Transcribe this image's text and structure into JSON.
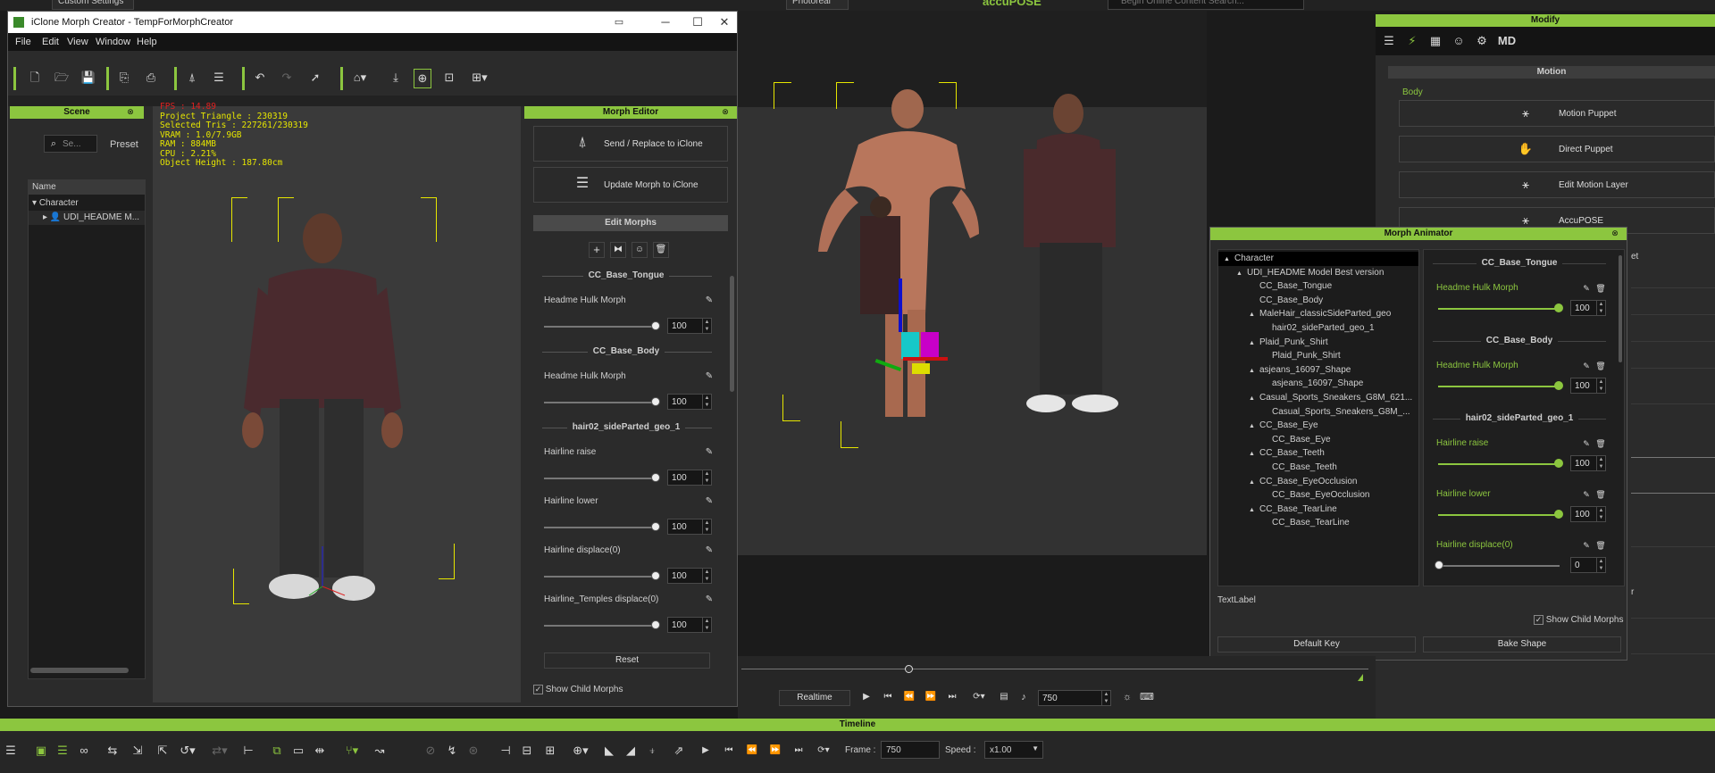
{
  "top_toolbar": {
    "preset_dropdown": "Custom Settings",
    "render_mode": "Photoreal",
    "accupose_logo": "accuPOSE",
    "search_placeholder": "Begin Online Content Search..."
  },
  "morph_creator": {
    "title": "iClone Morph Creator - TempForMorphCreator",
    "menu": [
      "File",
      "Edit",
      "View",
      "Window",
      "Help"
    ],
    "scene_panel": {
      "title": "Scene",
      "search_placeholder": "Se...",
      "preset_label": "Preset",
      "column_name": "Name",
      "tree": [
        {
          "label": "Character",
          "level": 0
        },
        {
          "label": "UDI_HEADME M...",
          "level": 1
        }
      ]
    },
    "stats": {
      "fps": "FPS : 14.89",
      "project_triangle": "Project Triangle : 230319",
      "selected_tris": "Selected Tris : 227261/230319",
      "vram": "VRAM : 1.0/7.9GB",
      "ram": "RAM : 884MB",
      "cpu": "CPU : 2.21%",
      "object_height": "Object Height : 187.80cm"
    },
    "morph_editor": {
      "title": "Morph Editor",
      "send_replace": "Send / Replace to iClone",
      "update_morph": "Update Morph to iClone",
      "edit_morphs": "Edit Morphs",
      "sections": [
        {
          "header": "CC_Base_Tongue",
          "items": [
            {
              "label": "Headme Hulk Morph",
              "value": "100",
              "fraction": 1.0
            }
          ]
        },
        {
          "header": "CC_Base_Body",
          "items": [
            {
              "label": "Headme Hulk Morph",
              "value": "100",
              "fraction": 1.0
            }
          ]
        },
        {
          "header": "hair02_sideParted_geo_1",
          "items": [
            {
              "label": "Hairline raise",
              "value": "100",
              "fraction": 1.0
            },
            {
              "label": "Hairline lower",
              "value": "100",
              "fraction": 1.0
            },
            {
              "label": "Hairline displace(0)",
              "value": "100",
              "fraction": 1.0
            },
            {
              "label": "Hairline_Temples displace(0)",
              "value": "100",
              "fraction": 1.0
            }
          ]
        }
      ],
      "reset": "Reset",
      "show_child_morphs": "Show Child Morphs"
    }
  },
  "modify_panel": {
    "title": "Modify",
    "motion_header": "Motion",
    "body_label": "Body",
    "buttons": [
      "Motion Puppet",
      "Direct Puppet",
      "Edit Motion Layer",
      "AccuPOSE"
    ],
    "partial_label": "et",
    "partial_label2": "r"
  },
  "morph_animator": {
    "title": "Morph Animator",
    "tree": [
      {
        "label": "Character",
        "level": 0,
        "exp": true
      },
      {
        "label": "UDI_HEADME Model Best version",
        "level": 1,
        "exp": true
      },
      {
        "label": "CC_Base_Tongue",
        "level": 2,
        "exp": false
      },
      {
        "label": "CC_Base_Body",
        "level": 2,
        "exp": false
      },
      {
        "label": "MaleHair_classicSideParted_geo",
        "level": 2,
        "exp": true
      },
      {
        "label": "hair02_sideParted_geo_1",
        "level": 3,
        "exp": false
      },
      {
        "label": "Plaid_Punk_Shirt",
        "level": 2,
        "exp": true
      },
      {
        "label": "Plaid_Punk_Shirt",
        "level": 3,
        "exp": false
      },
      {
        "label": "asjeans_16097_Shape",
        "level": 2,
        "exp": true
      },
      {
        "label": "asjeans_16097_Shape",
        "level": 3,
        "exp": false
      },
      {
        "label": "Casual_Sports_Sneakers_G8M_621...",
        "level": 2,
        "exp": true
      },
      {
        "label": "Casual_Sports_Sneakers_G8M_...",
        "level": 3,
        "exp": false
      },
      {
        "label": "CC_Base_Eye",
        "level": 2,
        "exp": true
      },
      {
        "label": "CC_Base_Eye",
        "level": 3,
        "exp": false
      },
      {
        "label": "CC_Base_Teeth",
        "level": 2,
        "exp": true
      },
      {
        "label": "CC_Base_Teeth",
        "level": 3,
        "exp": false
      },
      {
        "label": "CC_Base_EyeOcclusion",
        "level": 2,
        "exp": true
      },
      {
        "label": "CC_Base_EyeOcclusion",
        "level": 3,
        "exp": false
      },
      {
        "label": "CC_Base_TearLine",
        "level": 2,
        "exp": true
      },
      {
        "label": "CC_Base_TearLine",
        "level": 3,
        "exp": false
      }
    ],
    "sections": [
      {
        "header": "CC_Base_Tongue",
        "items": [
          {
            "label": "Headme Hulk Morph",
            "value": "100",
            "fraction": 1.0
          }
        ]
      },
      {
        "header": "CC_Base_Body",
        "items": [
          {
            "label": "Headme Hulk Morph",
            "value": "100",
            "fraction": 1.0
          }
        ]
      },
      {
        "header": "hair02_sideParted_geo_1",
        "items": [
          {
            "label": "Hairline raise",
            "value": "100",
            "fraction": 1.0
          },
          {
            "label": "Hairline lower",
            "value": "100",
            "fraction": 1.0
          },
          {
            "label": "Hairline displace(0)",
            "value": "0",
            "fraction": 0.0
          }
        ]
      }
    ],
    "text_label": "TextLabel",
    "show_child_morphs": "Show Child Morphs",
    "default_key": "Default Key",
    "bake_shape": "Bake Shape"
  },
  "playback": {
    "mode": "Realtime",
    "frame_value": "750"
  },
  "timeline": {
    "title": "Timeline",
    "frame_label": "Frame :",
    "frame_value": "750",
    "speed_label": "Speed :",
    "speed_value": "x1.00"
  },
  "colors": {
    "accent": "#8cc63f"
  }
}
